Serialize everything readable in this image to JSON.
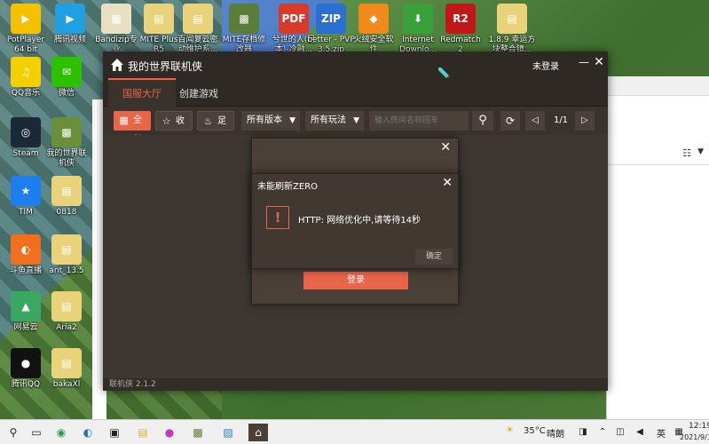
{
  "desktop": {
    "icons_top": [
      {
        "label": "PotPlayer\n64 bit",
        "color": "#f4c000",
        "glyph": "▶"
      },
      {
        "label": "腾讯视频",
        "color": "#20a0e0",
        "glyph": "▶"
      },
      {
        "label": "Bandizip专业\n破解版",
        "color": "#e8e0c0",
        "glyph": "▦"
      },
      {
        "label": "MITE Plus\nR5",
        "color": "#e8d27a",
        "glyph": "▤"
      },
      {
        "label": "百闻复云密\n动维护系...",
        "color": "#e8d27a",
        "glyph": "▤"
      },
      {
        "label": "MITE存档修\n改器v2.4.exe",
        "color": "#5a7d3a",
        "glyph": "▩"
      },
      {
        "label": "兮世的人(足\n本)-冷融...",
        "color": "#d93b2b",
        "glyph": "PDF"
      },
      {
        "label": "better - PVP\n3.5.zip",
        "color": "#2b6fd0",
        "glyph": "ZIP"
      },
      {
        "label": "火绒安全软\n件",
        "color": "#f08a1a",
        "glyph": "◆"
      },
      {
        "label": "Internet\nDownlo...",
        "color": "#3aa03a",
        "glyph": "⬇"
      },
      {
        "label": "Redmatch 2",
        "color": "#c01818",
        "glyph": "R2"
      },
      {
        "label": "1.8.9 幸运方\n块整合镜...",
        "color": "#e8d27a",
        "glyph": "▤"
      }
    ],
    "icons_left": [
      {
        "label": "QQ音乐",
        "color": "#f4d000",
        "glyph": "♫"
      },
      {
        "label": "微信",
        "color": "#2dc100",
        "glyph": "✉"
      },
      {
        "label": "Steam",
        "color": "#1b2838",
        "glyph": "◎"
      },
      {
        "label": "我的世界联\n机侠",
        "color": "#6a8f3a",
        "glyph": "▩"
      },
      {
        "label": "TIM",
        "color": "#1e7ef0",
        "glyph": "★"
      },
      {
        "label": "0818",
        "color": "#e8d27a",
        "glyph": "▤"
      },
      {
        "label": "斗鱼直播",
        "color": "#f07020",
        "glyph": "◐"
      },
      {
        "label": "ant_13.5",
        "color": "#e8d27a",
        "glyph": "▤"
      },
      {
        "label": "网易云",
        "color": "#3aa860",
        "glyph": "▲"
      },
      {
        "label": "Aria2",
        "color": "#e8d27a",
        "glyph": "▤"
      },
      {
        "label": "腾讯QQ",
        "color": "#111111",
        "glyph": "●"
      },
      {
        "label": "bakaXl",
        "color": "#e8d27a",
        "glyph": "▤"
      }
    ]
  },
  "app": {
    "title": "我的世界联机侠",
    "not_logged_in": "未登录",
    "tabs": [
      {
        "label": "国服大厅"
      },
      {
        "label": "创建游戏"
      }
    ],
    "toolbar": {
      "all": "全部",
      "favorite": "收藏",
      "footprint": "足迹",
      "version_dropdown": "所有版本",
      "mode_dropdown": "所有玩法",
      "search_placeholder": "输入房间名称回车",
      "page": "1/1"
    },
    "version": "联机侠 2.1.2",
    "login_button": "登录"
  },
  "error_dialog": {
    "title": "未能刷新ZERO",
    "icon": "!",
    "message": "HTTP: 网络优化中,请等待14秒",
    "ok": "确定"
  },
  "taskbar": {
    "temp": "35°C",
    "weather": "晴朗",
    "lang": "英",
    "time": "12:19",
    "date": "2021/9/1"
  },
  "colors": {
    "accent": "#e8654a",
    "window_bg": "#3a332d",
    "titlebar": "#2e2924"
  }
}
